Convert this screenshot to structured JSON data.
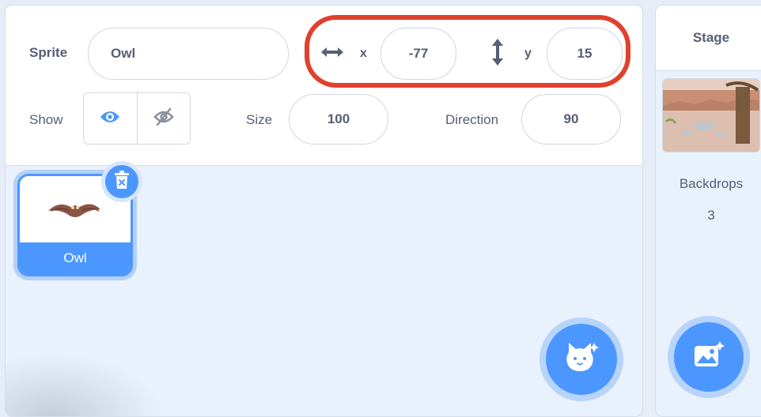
{
  "sprite_info": {
    "sprite_label": "Sprite",
    "sprite_name": "Owl",
    "x_label": "x",
    "x_value": "-77",
    "y_label": "y",
    "y_value": "15",
    "show_label": "Show",
    "size_label": "Size",
    "size_value": "100",
    "direction_label": "Direction",
    "direction_value": "90"
  },
  "sprites": [
    {
      "name": "Owl",
      "selected": true
    }
  ],
  "stage": {
    "header": "Stage",
    "backdrops_label": "Backdrops",
    "backdrops_count": "3"
  },
  "colors": {
    "accent": "#4c97ff",
    "highlight": "#e0402d",
    "text": "#575e75"
  },
  "icons": [
    "x-arrows-icon",
    "y-arrows-icon",
    "eye-icon",
    "eye-hidden-icon",
    "trash-icon",
    "choose-sprite-icon",
    "choose-backdrop-icon"
  ]
}
